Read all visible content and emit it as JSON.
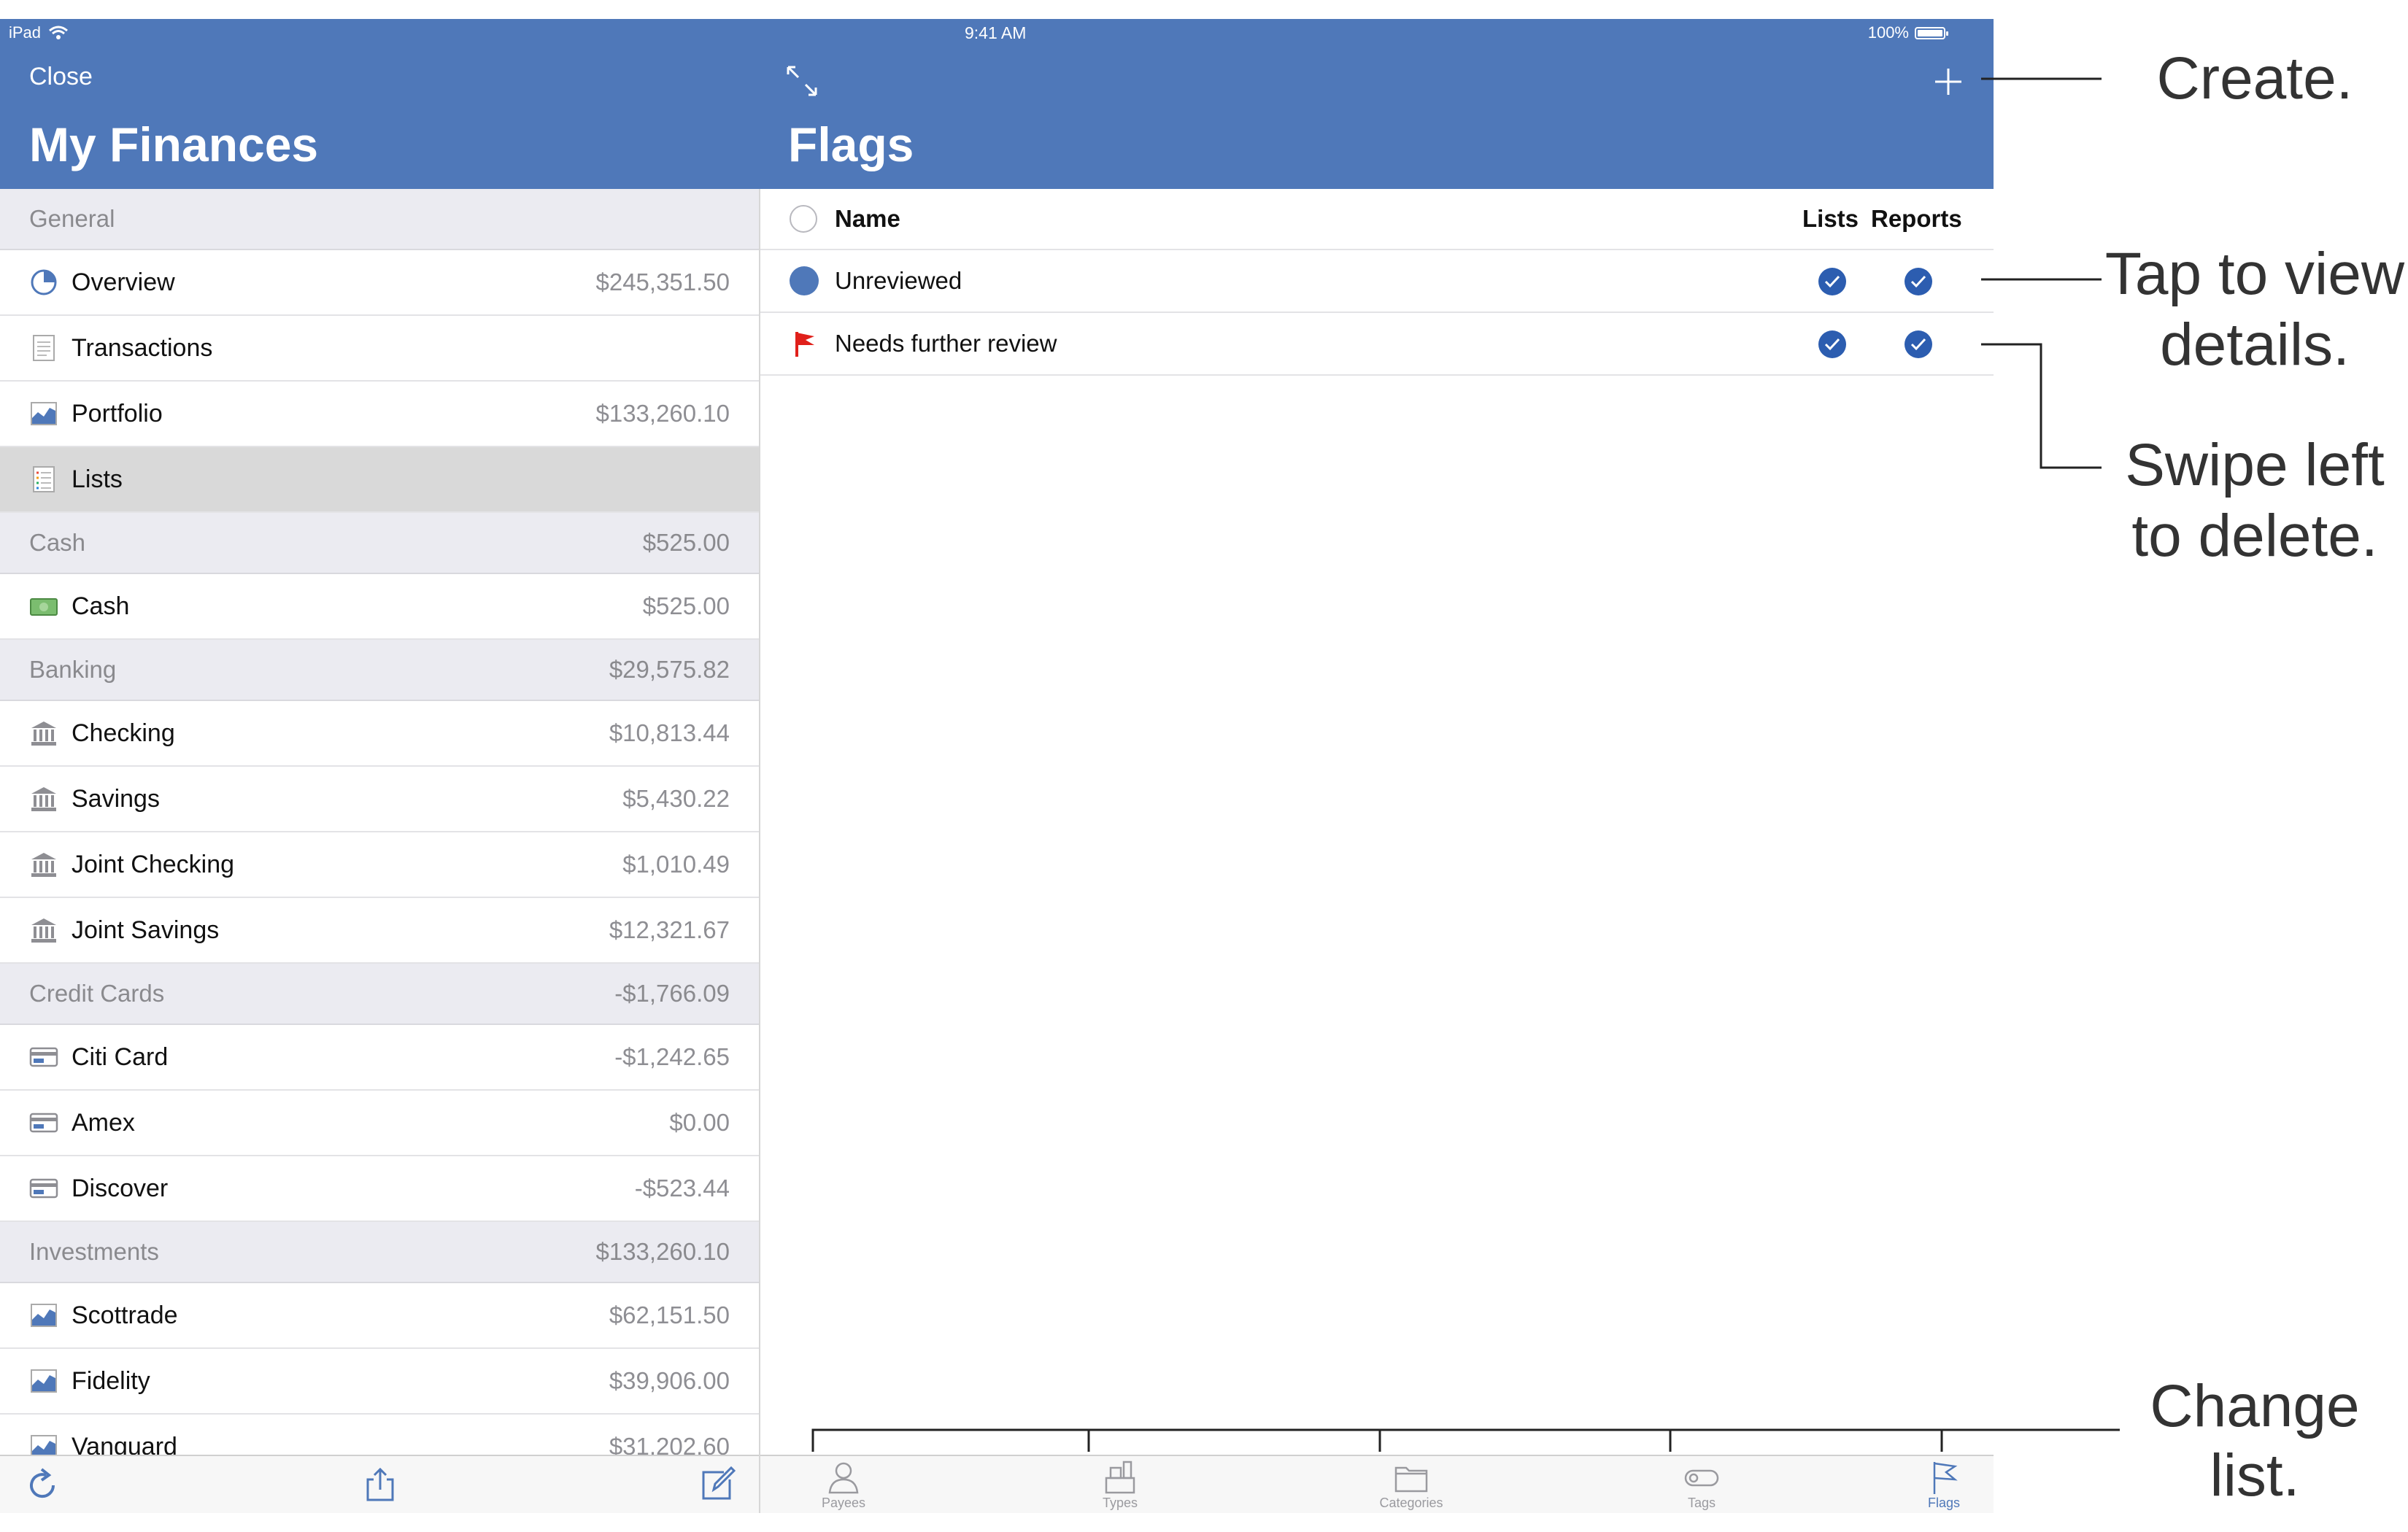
{
  "status_bar": {
    "device": "iPad",
    "time": "9:41 AM",
    "battery": "100%"
  },
  "sidebar": {
    "close_label": "Close",
    "title": "My Finances",
    "sections": [
      {
        "header": "General",
        "total": "",
        "rows": [
          {
            "label": "Overview",
            "amount": "$245,351.50",
            "icon": "pie-chart-icon"
          },
          {
            "label": "Transactions",
            "amount": "",
            "icon": "document-icon"
          },
          {
            "label": "Portfolio",
            "amount": "$133,260.10",
            "icon": "area-chart-icon"
          },
          {
            "label": "Lists",
            "amount": "",
            "icon": "list-icon",
            "selected": true
          }
        ]
      },
      {
        "header": "Cash",
        "total": "$525.00",
        "rows": [
          {
            "label": "Cash",
            "amount": "$525.00",
            "icon": "cash-icon"
          }
        ]
      },
      {
        "header": "Banking",
        "total": "$29,575.82",
        "rows": [
          {
            "label": "Checking",
            "amount": "$10,813.44",
            "icon": "bank-icon"
          },
          {
            "label": "Savings",
            "amount": "$5,430.22",
            "icon": "bank-icon"
          },
          {
            "label": "Joint Checking",
            "amount": "$1,010.49",
            "icon": "bank-icon"
          },
          {
            "label": "Joint Savings",
            "amount": "$12,321.67",
            "icon": "bank-icon"
          }
        ]
      },
      {
        "header": "Credit Cards",
        "total": "-$1,766.09",
        "rows": [
          {
            "label": "Citi Card",
            "amount": "-$1,242.65",
            "icon": "credit-card-icon"
          },
          {
            "label": "Amex",
            "amount": "$0.00",
            "icon": "credit-card-icon"
          },
          {
            "label": "Discover",
            "amount": "-$523.44",
            "icon": "credit-card-icon"
          }
        ]
      },
      {
        "header": "Investments",
        "total": "$133,260.10",
        "rows": [
          {
            "label": "Scottrade",
            "amount": "$62,151.50",
            "icon": "area-chart-icon"
          },
          {
            "label": "Fidelity",
            "amount": "$39,906.00",
            "icon": "area-chart-icon"
          },
          {
            "label": "Vanguard",
            "amount": "$31,202.60",
            "icon": "area-chart-icon"
          }
        ]
      }
    ],
    "toolbar": [
      "refresh-icon",
      "share-icon",
      "edit-icon"
    ]
  },
  "main": {
    "title": "Flags",
    "columns": {
      "name": "Name",
      "lists": "Lists",
      "reports": "Reports"
    },
    "rows": [
      {
        "name": "Unreviewed",
        "icon": "blue-dot-icon",
        "lists": true,
        "reports": true
      },
      {
        "name": "Needs further review",
        "icon": "red-flag-icon",
        "lists": true,
        "reports": true
      }
    ]
  },
  "tabbar": {
    "tabs": [
      {
        "label": "Payees",
        "icon": "person-icon"
      },
      {
        "label": "Types",
        "icon": "register-icon"
      },
      {
        "label": "Categories",
        "icon": "folder-icon"
      },
      {
        "label": "Tags",
        "icon": "tag-toggle-icon"
      },
      {
        "label": "Flags",
        "icon": "flag-icon",
        "active": true
      }
    ]
  },
  "annotations": {
    "create": "Create.",
    "tap_line1": "Tap to view",
    "tap_line2": "details.",
    "swipe_line1": "Swipe left",
    "swipe_line2": "to delete.",
    "change_line1": "Change",
    "change_line2": "list."
  },
  "colors": {
    "accent": "#4f78b9",
    "flag_red": "#e0201b"
  }
}
